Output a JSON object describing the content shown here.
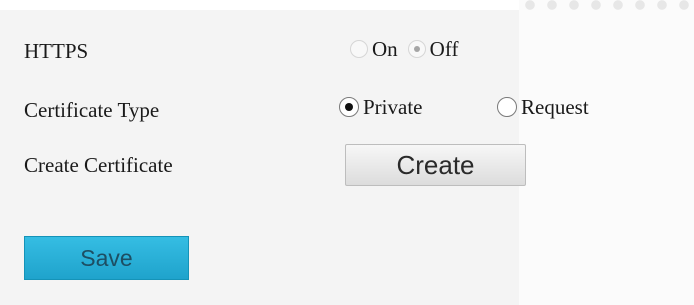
{
  "https": {
    "label": "HTTPS",
    "options": [
      {
        "label": "On",
        "selected": false
      },
      {
        "label": "Off",
        "selected": true
      }
    ]
  },
  "certificate_type": {
    "label": "Certificate Type",
    "options": [
      {
        "label": "Private",
        "selected": true
      },
      {
        "label": "Request",
        "selected": false
      }
    ]
  },
  "create_certificate": {
    "label": "Create Certificate",
    "button_label": "Create"
  },
  "save": {
    "label": "Save"
  },
  "colors": {
    "save_button": "#28b0d9",
    "panel_background": "#f4f4f4"
  }
}
